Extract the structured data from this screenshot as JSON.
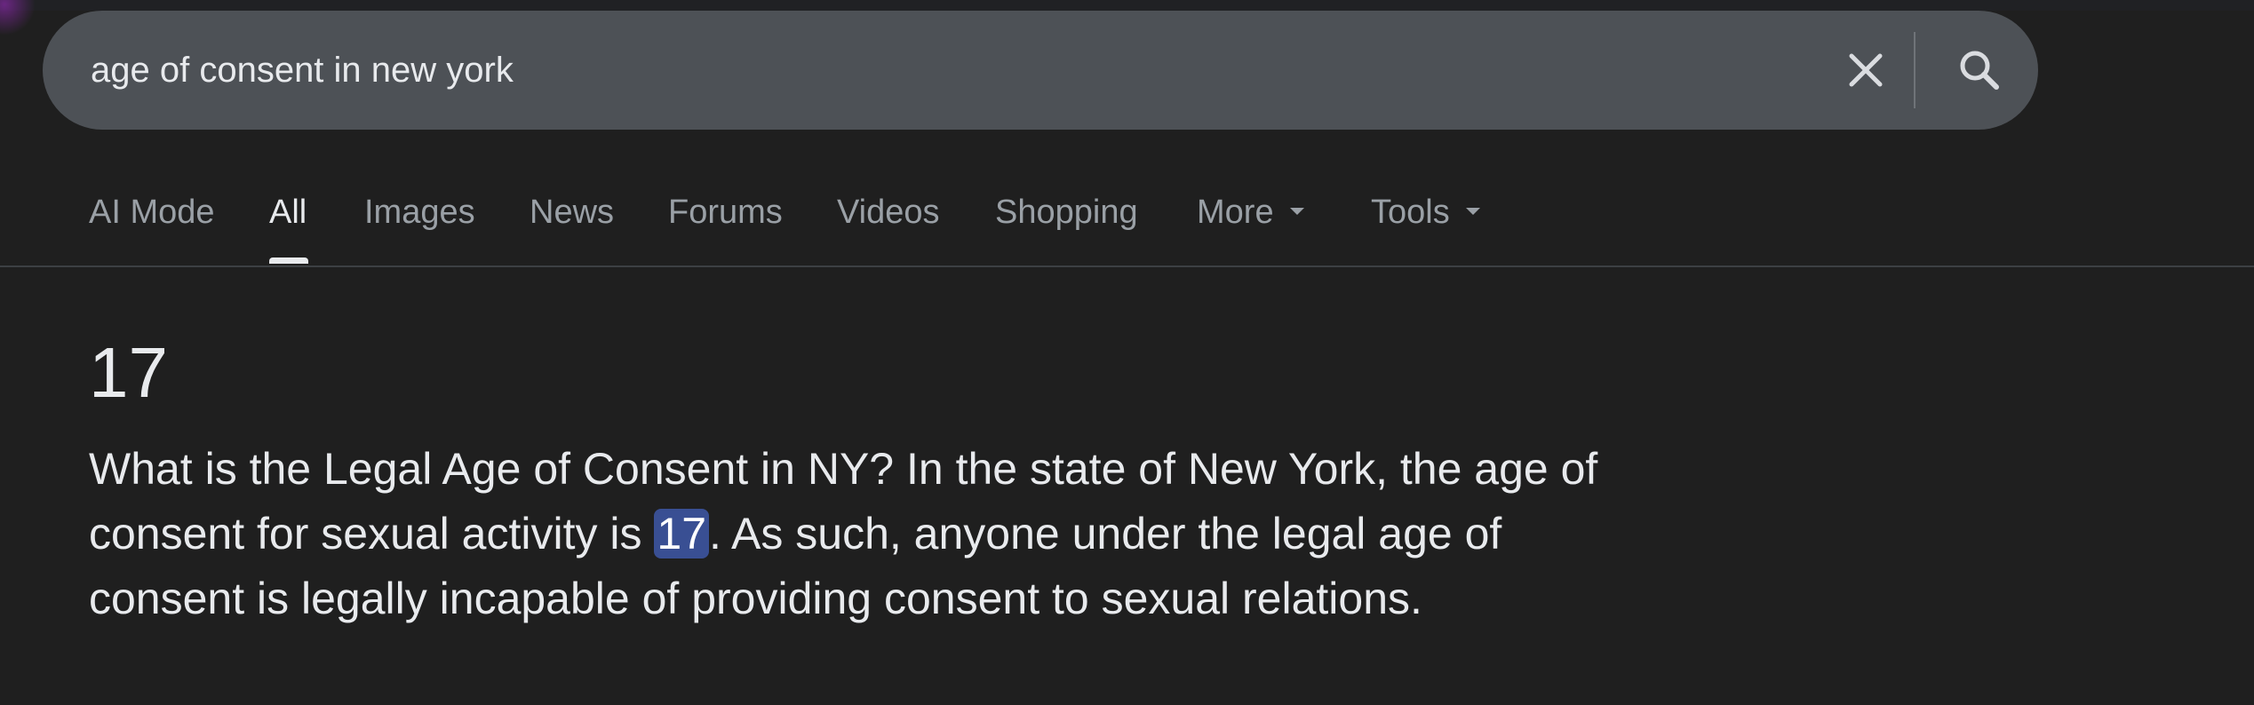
{
  "search": {
    "query": "age of consent in new york",
    "clear_icon": "close-icon",
    "search_icon": "search-icon"
  },
  "tabs": [
    {
      "label": "AI Mode",
      "active": false
    },
    {
      "label": "All",
      "active": true
    },
    {
      "label": "Images",
      "active": false
    },
    {
      "label": "News",
      "active": false
    },
    {
      "label": "Forums",
      "active": false
    },
    {
      "label": "Videos",
      "active": false
    },
    {
      "label": "Shopping",
      "active": false
    },
    {
      "label": "More",
      "active": false,
      "has_dropdown": true
    },
    {
      "label": "Tools",
      "active": false,
      "has_dropdown": true
    }
  ],
  "result": {
    "answer": "17",
    "snippet_before": "What is the Legal Age of Consent in NY? In the state of New York, the age of consent for sexual activity is ",
    "snippet_highlight": "17",
    "snippet_after": ". As such, anyone under the legal age of consent is legally incapable of providing consent to sexual relations."
  },
  "colors": {
    "background": "#1f1f1f",
    "searchbar": "#4d5156",
    "highlight": "#394f93",
    "text_primary": "#e8eaed",
    "text_secondary": "#9aa0a6"
  }
}
